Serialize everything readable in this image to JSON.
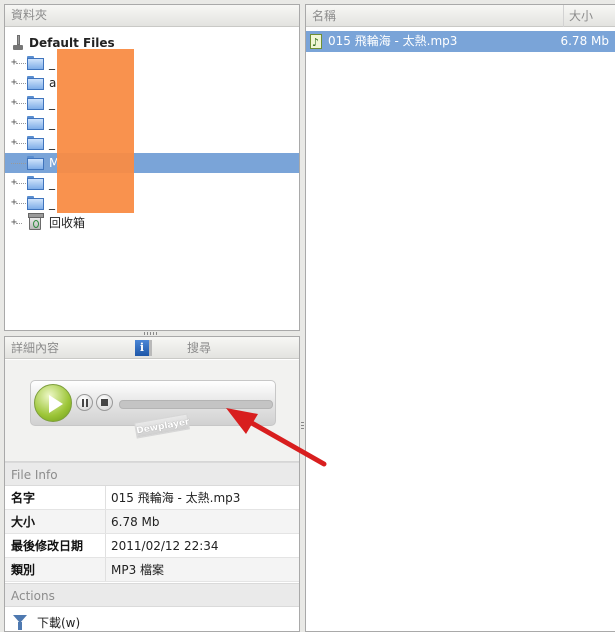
{
  "folder_panel": {
    "header": "資料夾",
    "root_label": "Default Files",
    "folders": [
      {
        "label": "_",
        "selected": false
      },
      {
        "label": "a",
        "selected": false
      },
      {
        "label": "_",
        "selected": false
      },
      {
        "label": "_",
        "selected": false
      },
      {
        "label": "_",
        "selected": false
      },
      {
        "label": "M",
        "selected": true
      },
      {
        "label": "_",
        "selected": false
      },
      {
        "label": "_",
        "selected": false
      }
    ],
    "trash_label": "回收箱"
  },
  "details_panel": {
    "tab_details": "詳細內容",
    "tab_search": "搜尋",
    "info_icon": "i",
    "player_brand": "Dewplayer",
    "file_info_header": "File Info",
    "rows": [
      {
        "key": "名字",
        "value": "015 飛輪海 - 太熱.mp3"
      },
      {
        "key": "大小",
        "value": "6.78 Mb"
      },
      {
        "key": "最後修改日期",
        "value": "2011/02/12 22:34"
      },
      {
        "key": "類別",
        "value": "MP3 檔案"
      }
    ],
    "actions_header": "Actions",
    "download_label": "下載(w)"
  },
  "file_list": {
    "col_name": "名稱",
    "col_size": "大小",
    "files": [
      {
        "name": "015 飛輪海 - 太熱.mp3",
        "size": "6.78 Mb",
        "selected": true
      }
    ]
  },
  "colors": {
    "selection": "#7aa4d8",
    "annotation_arrow": "#d81e1e",
    "redaction": "#f98c44",
    "play_button": "#9cc537"
  }
}
